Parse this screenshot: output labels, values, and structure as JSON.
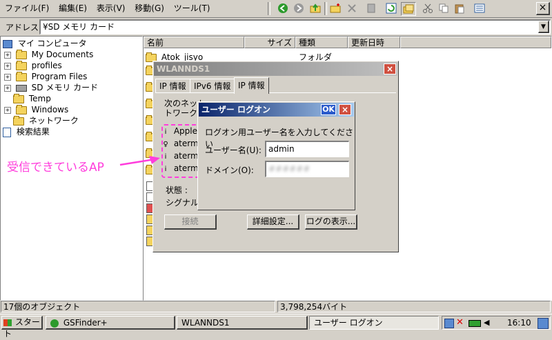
{
  "menu": {
    "file": "ファイル(F)",
    "edit": "編集(E)",
    "view": "表示(V)",
    "go": "移動(G)",
    "tools": "ツール(T)"
  },
  "address": {
    "label": "アドレス:",
    "value": "¥SD メモリ カード"
  },
  "tree": {
    "root": "マイ コンピュータ",
    "items": [
      "My Documents",
      "profiles",
      "Program Files",
      "SD メモリ カード",
      "Temp",
      "Windows",
      "ネットワーク"
    ],
    "search": "検索結果"
  },
  "list": {
    "headers": {
      "name": "名前",
      "size": "サイズ",
      "type": "種類",
      "date": "更新日時"
    },
    "first_row": {
      "name": "Atok_jisyo",
      "type": "フォルダ"
    }
  },
  "wlan": {
    "title": "WLANNDS1",
    "tabs": [
      "IP 情報",
      "IPv6 情報",
      "IP 情報"
    ],
    "intro_line1": "次のネット",
    "intro_line2": "トワーク名",
    "networks": [
      "Apple",
      "aterm",
      "aterm",
      "aterm"
    ],
    "status_label": "状態 :",
    "signal_label": "シグナルの",
    "connect_btn": "接続",
    "advanced_btn": "詳細設定...",
    "log_btn": "ログの表示..."
  },
  "logon": {
    "title": "ユーザー ログオン",
    "ok": "OK",
    "prompt": "ログオン用ユーザー名を入力してください",
    "user_label": "ユーザー名(U):",
    "user_value": "admin",
    "domain_label": "ドメイン(O):",
    "domain_value": "######"
  },
  "annotation": {
    "text": "受信できているAP",
    "color": "#ff3cdc"
  },
  "status": {
    "count": "17個のオブジェクト",
    "size": "3,798,254バイト"
  },
  "taskbar": {
    "start": "スタート",
    "tasks": [
      "GSFinder+",
      "WLANNDS1",
      "ユーザー ログオン"
    ],
    "clock": "16:10"
  }
}
